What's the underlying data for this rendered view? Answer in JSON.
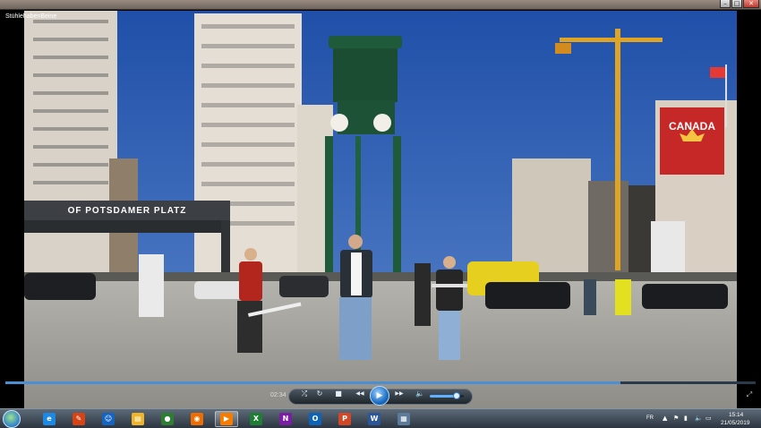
{
  "window": {
    "title": "StühlehabenBeine",
    "controls": {
      "minimize": "–",
      "maximize": "□",
      "close": "✕"
    }
  },
  "scene": {
    "station_sign": "OF POTSDAMER PLATZ",
    "billboard_text": "CANADA"
  },
  "player": {
    "elapsed": "02:34",
    "progress_fraction": 0.82,
    "volume_fraction": 0.8,
    "icons": [
      "shuffle-icon",
      "repeat-icon",
      "stop-icon",
      "previous-icon",
      "play-icon",
      "next-icon",
      "volume-icon",
      "fullscreen-icon"
    ],
    "play_glyph": "▶",
    "stop_glyph": "■",
    "prev_glyph": "◀◀",
    "next_glyph": "▶▶",
    "shuffle_glyph": "⤮",
    "repeat_glyph": "↻",
    "volume_glyph": "🔈",
    "fullscreen_glyph": "⤢"
  },
  "taskbar": {
    "apps": [
      {
        "name": "internet-explorer",
        "glyph": "e",
        "color": "#1e88e5",
        "active": false
      },
      {
        "name": "paint",
        "glyph": "✎",
        "color": "#d84315",
        "active": false
      },
      {
        "name": "messenger",
        "glyph": "☺",
        "color": "#1565c0",
        "active": false
      },
      {
        "name": "file-explorer",
        "glyph": "▤",
        "color": "#f0b429",
        "active": false
      },
      {
        "name": "chrome",
        "glyph": "●",
        "color": "#2e7d32",
        "active": false
      },
      {
        "name": "firefox",
        "glyph": "◉",
        "color": "#ef6c00",
        "active": false
      },
      {
        "name": "media-player",
        "glyph": "▶",
        "color": "#f57c00",
        "active": true
      },
      {
        "name": "excel",
        "glyph": "X",
        "color": "#1e7e34",
        "active": false
      },
      {
        "name": "onenote",
        "glyph": "N",
        "color": "#7b1fa2",
        "active": false
      },
      {
        "name": "outlook",
        "glyph": "O",
        "color": "#0d63b8",
        "active": false
      },
      {
        "name": "powerpoint",
        "glyph": "P",
        "color": "#d24726",
        "active": false
      },
      {
        "name": "word",
        "glyph": "W",
        "color": "#2b579a",
        "active": false
      },
      {
        "name": "photos",
        "glyph": "▦",
        "color": "#5c7a99",
        "active": false
      }
    ],
    "language": "FR",
    "time": "15:14",
    "date": "21/05/2019"
  },
  "colors": {
    "accent": "#4a8fd4",
    "sky": "#2f5fb3",
    "pavement": "#a9a7a1"
  }
}
